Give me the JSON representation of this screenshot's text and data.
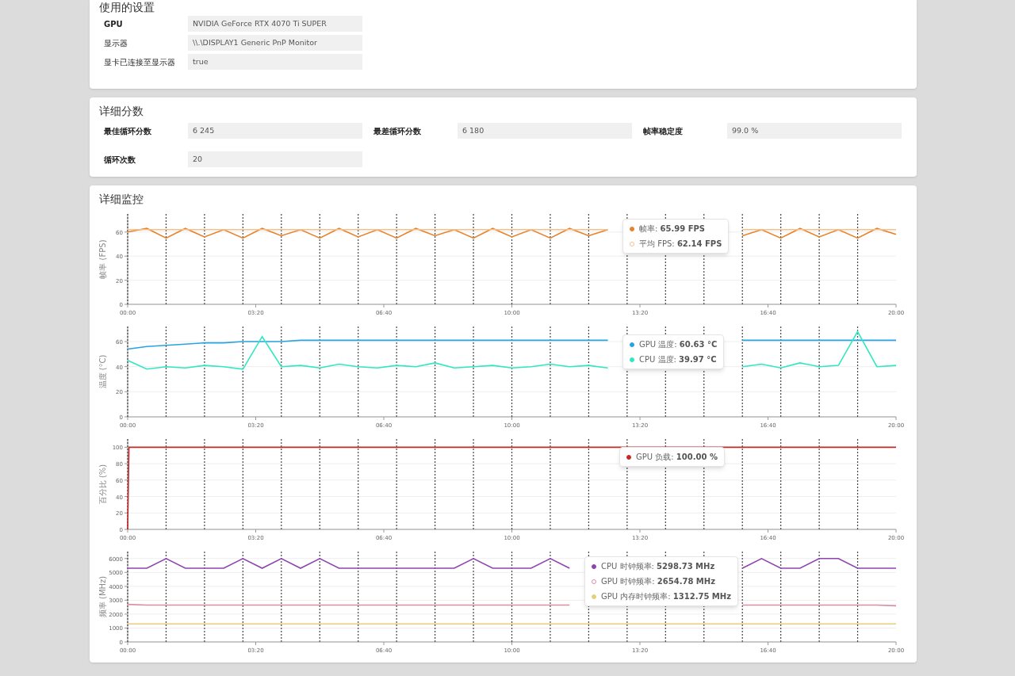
{
  "settings": {
    "title": "使用的设置",
    "rows": [
      {
        "label": "GPU",
        "value": "NVIDIA GeForce RTX 4070 Ti SUPER"
      },
      {
        "label": "显示器",
        "value": "\\\\.\\DISPLAY1 Generic PnP Monitor"
      },
      {
        "label": "显卡已连接至显示器",
        "value": "true"
      }
    ]
  },
  "scores": {
    "title": "详细分数",
    "fields": [
      {
        "label": "最佳循环分数",
        "value": "6 245"
      },
      {
        "label": "最差循环分数",
        "value": "6 180"
      },
      {
        "label": "帧率稳定度",
        "value": "99.0 %"
      },
      {
        "label": "循环次数",
        "value": "20"
      }
    ]
  },
  "monitoring": {
    "title": "详细监控",
    "charts": [
      {
        "chart_data": {
          "type": "line",
          "ylabel": "帧率 (FPS)",
          "grid": true,
          "legend": "upper right",
          "xlim": [
            0,
            1200
          ],
          "ylim": [
            0,
            75
          ],
          "yticks": [
            0,
            20,
            40,
            60
          ],
          "xticks": [
            {
              "value": 0,
              "label": "00:00"
            },
            {
              "value": 200,
              "label": "03:20"
            },
            {
              "value": 400,
              "label": "06:40"
            },
            {
              "value": 600,
              "label": "10:00"
            },
            {
              "value": 800,
              "label": "13:20"
            },
            {
              "value": 1000,
              "label": "16:40"
            },
            {
              "value": 1200,
              "label": "20:00"
            }
          ],
          "x": [
            0,
            30,
            60,
            90,
            120,
            150,
            180,
            210,
            240,
            270,
            300,
            330,
            360,
            390,
            420,
            450,
            480,
            510,
            540,
            570,
            600,
            630,
            660,
            690,
            720,
            750,
            960,
            990,
            1020,
            1050,
            1080,
            1110,
            1140,
            1170,
            1200
          ],
          "series": [
            {
              "name": "帧率",
              "color": "#e8822a",
              "values": [
                60,
                63,
                55,
                63,
                56,
                62,
                55,
                63,
                57,
                62,
                55,
                63,
                56,
                62,
                55,
                63,
                57,
                62,
                55,
                63,
                56,
                62,
                55,
                63,
                57,
                62,
                57,
                62,
                55,
                63,
                56,
                62,
                55,
                63,
                58
              ]
            },
            {
              "name": "平均 FPS",
              "color": "#f5c08a",
              "values": [
                62,
                62,
                62,
                62,
                62,
                62,
                62,
                62,
                62,
                62,
                62,
                62,
                62,
                62,
                62,
                62,
                62,
                62,
                62,
                62,
                62,
                62,
                62,
                62,
                62,
                62,
                62,
                62,
                62,
                62,
                62,
                62,
                62,
                62,
                62
              ]
            }
          ]
        },
        "tooltip": {
          "separator": ":",
          "items": [
            {
              "kind": "filled",
              "value": "65.99 FPS"
            },
            {
              "kind": "hollow",
              "value": "62.14 FPS"
            }
          ]
        }
      },
      {
        "chart_data": {
          "type": "line",
          "ylabel": "温度 (°C)",
          "grid": true,
          "legend": "upper right",
          "xlim": [
            0,
            1200
          ],
          "ylim": [
            0,
            72
          ],
          "yticks": [
            0,
            20,
            40,
            60
          ],
          "xticks": [
            {
              "value": 0,
              "label": "00:00"
            },
            {
              "value": 200,
              "label": "03:20"
            },
            {
              "value": 400,
              "label": "06:40"
            },
            {
              "value": 600,
              "label": "10:00"
            },
            {
              "value": 800,
              "label": "13:20"
            },
            {
              "value": 1000,
              "label": "16:40"
            },
            {
              "value": 1200,
              "label": "20:00"
            }
          ],
          "x": [
            0,
            30,
            60,
            90,
            120,
            150,
            180,
            210,
            240,
            270,
            300,
            330,
            360,
            390,
            420,
            450,
            480,
            510,
            540,
            570,
            600,
            630,
            660,
            690,
            720,
            750,
            960,
            990,
            1020,
            1050,
            1080,
            1110,
            1140,
            1170,
            1200
          ],
          "series": [
            {
              "name": "GPU 温度",
              "color": "#29a3e0",
              "values": [
                54,
                56,
                57,
                58,
                59,
                59,
                60,
                60,
                60,
                61,
                61,
                61,
                61,
                61,
                61,
                61,
                61,
                61,
                61,
                61,
                61,
                61,
                61,
                61,
                61,
                61,
                61,
                61,
                61,
                61,
                61,
                61,
                61,
                61,
                61
              ]
            },
            {
              "name": "CPU 温度",
              "color": "#2ee8c0",
              "values": [
                45,
                38,
                40,
                39,
                41,
                40,
                38,
                64,
                40,
                41,
                39,
                42,
                40,
                39,
                41,
                40,
                43,
                39,
                40,
                41,
                39,
                40,
                42,
                40,
                41,
                39,
                40,
                42,
                39,
                43,
                40,
                41,
                68,
                40,
                41
              ]
            }
          ]
        },
        "tooltip": {
          "separator": ":",
          "items": [
            {
              "kind": "filled",
              "value": "60.63 °C"
            },
            {
              "kind": "filled",
              "value": "39.97 °C"
            }
          ]
        }
      },
      {
        "chart_data": {
          "type": "line",
          "ylabel": "百分比 (%)",
          "grid": true,
          "legend": "upper right",
          "xlim": [
            0,
            1200
          ],
          "ylim": [
            0,
            110
          ],
          "yticks": [
            0,
            20,
            40,
            60,
            80,
            100
          ],
          "xticks": [
            {
              "value": 0,
              "label": "00:00"
            },
            {
              "value": 200,
              "label": "03:20"
            },
            {
              "value": 400,
              "label": "06:40"
            },
            {
              "value": 600,
              "label": "10:00"
            },
            {
              "value": 800,
              "label": "13:20"
            },
            {
              "value": 1000,
              "label": "16:40"
            },
            {
              "value": 1200,
              "label": "20:00"
            }
          ],
          "x": [
            0,
            2,
            30,
            60,
            90,
            120,
            150,
            180,
            210,
            240,
            270,
            300,
            330,
            360,
            390,
            420,
            450,
            480,
            510,
            540,
            570,
            600,
            630,
            660,
            690,
            720,
            750,
            780,
            810,
            840,
            870,
            900,
            930,
            960,
            990,
            1020,
            1050,
            1080,
            1110,
            1140,
            1170,
            1200
          ],
          "series": [
            {
              "name": "GPU 负载",
              "color": "#c62828",
              "values": [
                0,
                100,
                100,
                100,
                100,
                100,
                100,
                100,
                100,
                100,
                100,
                100,
                100,
                100,
                100,
                100,
                100,
                100,
                100,
                100,
                100,
                100,
                100,
                100,
                100,
                100,
                100,
                100,
                100,
                100,
                100,
                100,
                100,
                100,
                100,
                100,
                100,
                100,
                100,
                100,
                100,
                100
              ]
            }
          ]
        },
        "tooltip": {
          "separator": ":",
          "items": [
            {
              "kind": "filled",
              "value": "100.00 %"
            }
          ]
        }
      },
      {
        "chart_data": {
          "type": "line",
          "ylabel": "频率 (MHz)",
          "grid": true,
          "legend": "upper right",
          "xlim": [
            0,
            1200
          ],
          "ylim": [
            0,
            6500
          ],
          "yticks": [
            0,
            1000,
            2000,
            3000,
            4000,
            5000,
            6000
          ],
          "xticks": [
            {
              "value": 0,
              "label": "00:00"
            },
            {
              "value": 200,
              "label": "03:20"
            },
            {
              "value": 400,
              "label": "06:40"
            },
            {
              "value": 600,
              "label": "10:00"
            },
            {
              "value": 800,
              "label": "13:20"
            },
            {
              "value": 1000,
              "label": "16:40"
            },
            {
              "value": 1200,
              "label": "20:00"
            }
          ],
          "x": [
            0,
            30,
            60,
            90,
            120,
            150,
            180,
            210,
            240,
            270,
            300,
            330,
            360,
            390,
            420,
            450,
            480,
            510,
            540,
            570,
            600,
            630,
            660,
            690,
            720,
            750,
            780,
            810,
            840,
            870,
            900,
            930,
            960,
            990,
            1020,
            1050,
            1080,
            1110,
            1140,
            1170,
            1200
          ],
          "series": [
            {
              "name": "CPU 时钟频率",
              "color": "#8e44ad",
              "values": [
                5300,
                5300,
                6000,
                5300,
                5300,
                5300,
                6000,
                5300,
                6000,
                5300,
                6000,
                5300,
                5300,
                5300,
                5300,
                5300,
                5300,
                5300,
                6000,
                5300,
                5300,
                5300,
                6000,
                5300,
                null,
                null,
                null,
                null,
                null,
                null,
                null,
                null,
                5300,
                6000,
                5300,
                5300,
                6000,
                6000,
                5300,
                5300,
                5300
              ]
            },
            {
              "name": "GPU 时钟频率",
              "color": "#d98fa0",
              "values": [
                2700,
                2650,
                2650,
                2650,
                2650,
                2650,
                2650,
                2650,
                2650,
                2650,
                2650,
                2650,
                2650,
                2650,
                2650,
                2650,
                2650,
                2650,
                2650,
                2650,
                2650,
                2650,
                2650,
                2650,
                null,
                null,
                null,
                null,
                null,
                null,
                null,
                null,
                2650,
                2650,
                2650,
                2650,
                2650,
                2650,
                2650,
                2650,
                2600
              ]
            },
            {
              "name": "GPU 内存时钟频率",
              "color": "#e6cf7a",
              "values": [
                1300,
                1300,
                1300,
                1300,
                1300,
                1300,
                1300,
                1300,
                1300,
                1300,
                1300,
                1300,
                1300,
                1300,
                1300,
                1300,
                1300,
                1300,
                1300,
                1300,
                1300,
                1300,
                1300,
                1300,
                1300,
                1300,
                1300,
                1300,
                1300,
                1300,
                1300,
                1300,
                1300,
                1300,
                1300,
                1300,
                1300,
                1300,
                1300,
                1300,
                1300
              ]
            }
          ]
        },
        "tooltip": {
          "separator": ":",
          "items": [
            {
              "kind": "filled",
              "value": "5298.73 MHz"
            },
            {
              "kind": "hollow",
              "value": "2654.78 MHz"
            },
            {
              "kind": "filled",
              "value": "1312.75 MHz"
            }
          ]
        }
      }
    ]
  }
}
